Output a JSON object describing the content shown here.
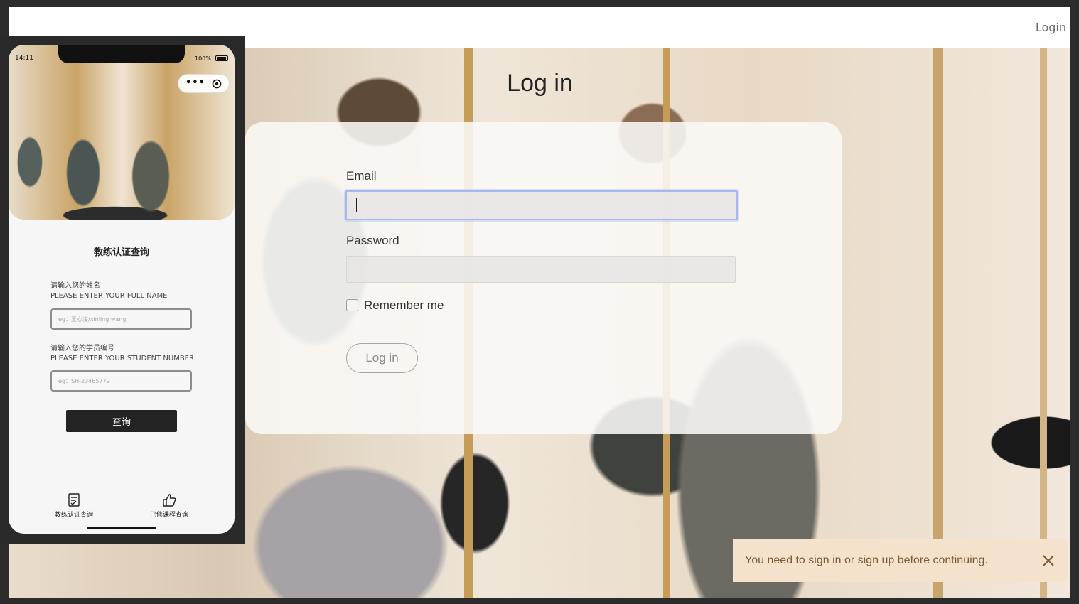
{
  "web": {
    "header_login": "Login",
    "page_title": "Log in",
    "email_label": "Email",
    "email_value": "",
    "password_label": "Password",
    "password_value": "",
    "remember_label": "Remember me",
    "remember_checked": false,
    "login_button": "Log in",
    "flash_message": "You need to sign in or sign up before continuing."
  },
  "phone": {
    "status_time": "14:11",
    "battery_text": "100%",
    "title": "教练认证查询",
    "name_label_cn": "请输入您的姓名",
    "name_label_en": "PLEASE ENTER YOUR FULL NAME",
    "name_placeholder": "eg：王心凌/xinling wang",
    "student_label_cn": "请输入您的学员编号",
    "student_label_en": "PLEASE ENTER YOUR STUDENT NUMBER",
    "student_placeholder": "eg：SH-23465779",
    "query_button": "查询",
    "tabs": [
      {
        "label": "教练认证查询",
        "icon": "certificate-icon"
      },
      {
        "label": "已修课程查询",
        "icon": "thumbs-up-icon"
      }
    ]
  },
  "colors": {
    "flash_bg": "#f4e2cd",
    "flash_text": "#7a5a3b",
    "focus_ring": "#a8b8ee",
    "phone_button": "#232323"
  }
}
